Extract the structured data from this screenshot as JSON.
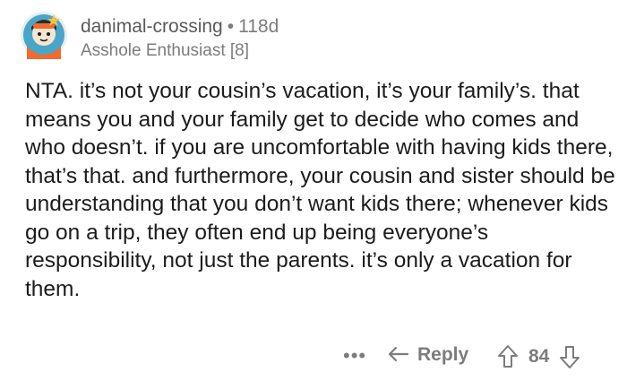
{
  "comment": {
    "author": "danimal-crossing",
    "separator": "•",
    "age": "118d",
    "flair": "Asshole Enthusiast [8]",
    "avatar_icon": "avatar-icon",
    "body": "NTA. it’s not your cousin’s vacation, it’s your family’s. that means you and your family get to decide who comes and who doesn’t. if you are uncomfortable with having kids there, that’s that. and furthermore, your cousin and sister should be understanding that you don’t want kids there; whenever kids go on a trip, they often end up being everyone’s responsibility, not just the parents. it’s only a vacation for them."
  },
  "actions": {
    "more_label": "•••",
    "reply_label": "Reply",
    "reply_icon": "reply-arrow-icon",
    "score": "84",
    "upvote_icon": "upvote-arrow-icon",
    "downvote_icon": "downvote-arrow-icon"
  },
  "colors": {
    "muted": "#7c7c7c",
    "text": "#1c1c1c",
    "avatar_bg": "#4aa6c9",
    "avatar_accent": "#f26a2e"
  }
}
